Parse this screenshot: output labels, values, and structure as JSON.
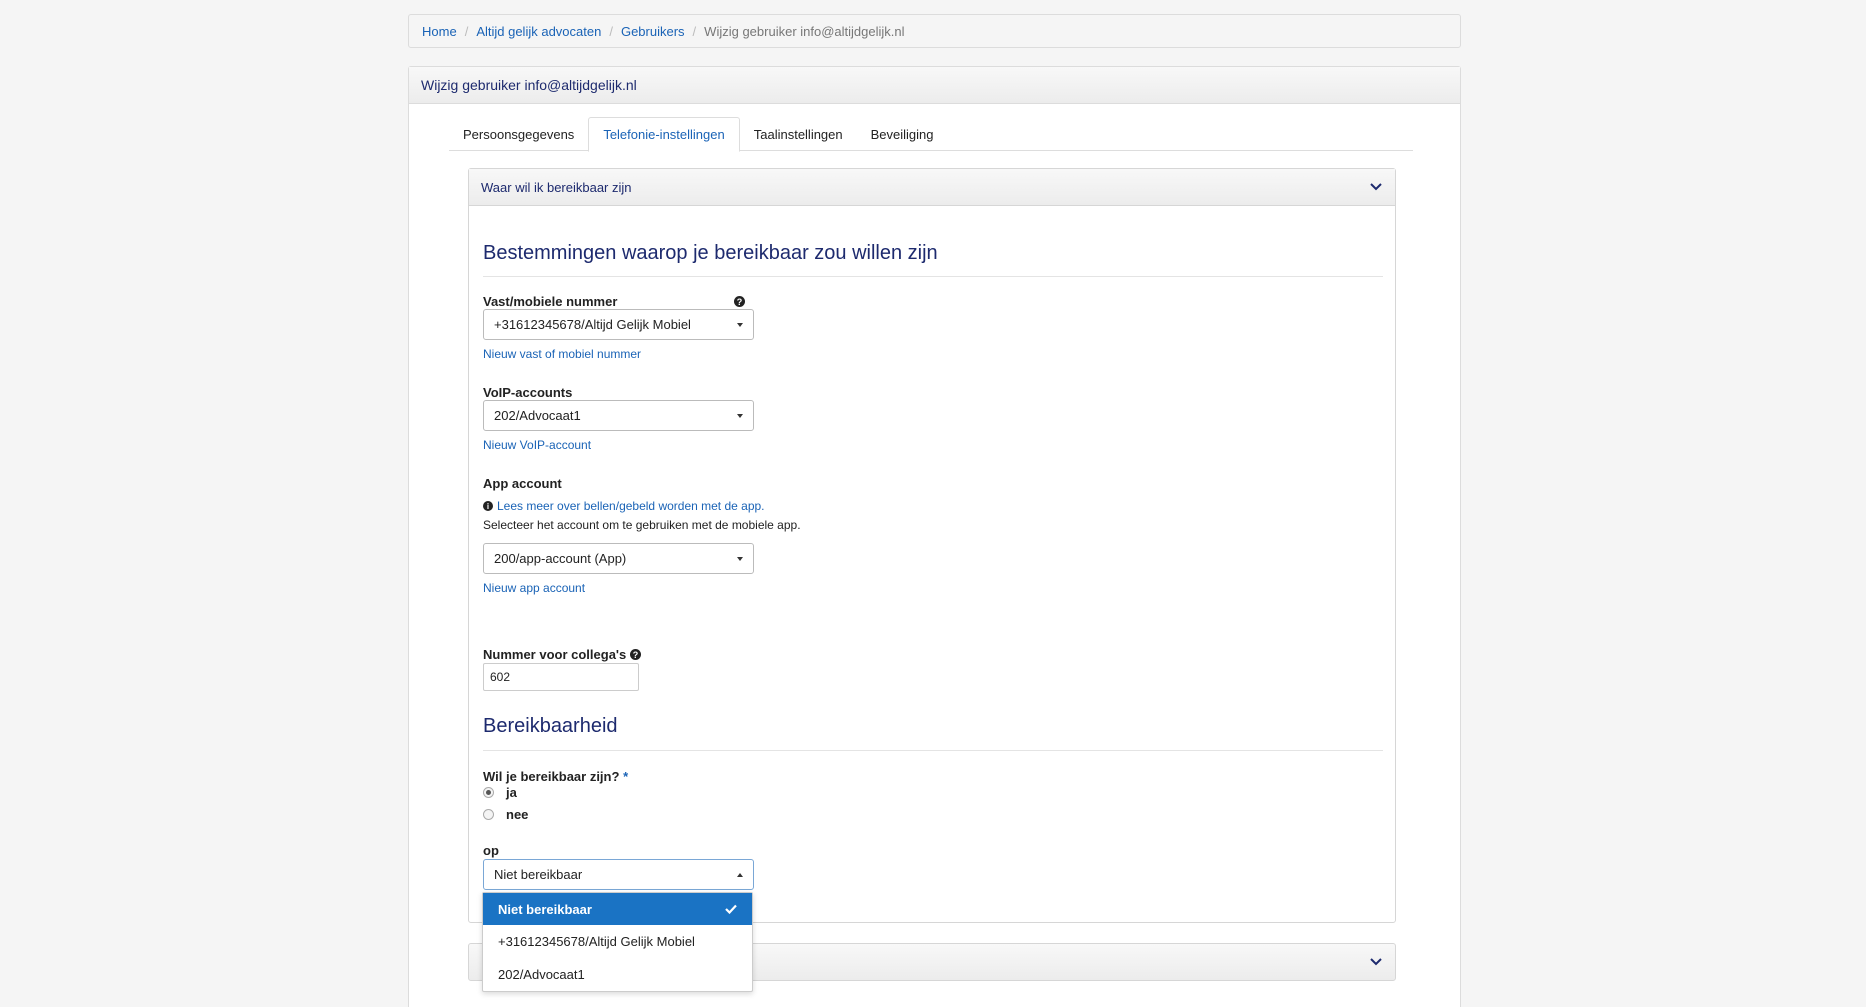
{
  "breadcrumb": {
    "home": "Home",
    "org": "Altijd gelijk advocaten",
    "users": "Gebruikers",
    "current": "Wijzig gebruiker info@altijdgelijk.nl",
    "separator": "/"
  },
  "panel": {
    "title": "Wijzig gebruiker info@altijdgelijk.nl"
  },
  "tabs": [
    {
      "label": "Persoonsgegevens",
      "active": false
    },
    {
      "label": "Telefonie-instellingen",
      "active": true
    },
    {
      "label": "Taalinstellingen",
      "active": false
    },
    {
      "label": "Beveiliging",
      "active": false
    }
  ],
  "accordion": {
    "title": "Waar wil ik bereikbaar zijn",
    "section1_title": "Bestemmingen waarop je bereikbaar zou willen zijn",
    "fixed_mobile": {
      "label": "Vast/mobiele nummer",
      "value": "+31612345678/Altijd Gelijk Mobiel",
      "link": "Nieuw vast of mobiel nummer"
    },
    "voip": {
      "label": "VoIP-accounts",
      "value": "202/Advocaat1",
      "link": "Nieuw VoIP-account"
    },
    "app": {
      "label": "App account",
      "info_link": "Lees meer over bellen/gebeld worden met de app.",
      "help_text": "Selecteer het account om te gebruiken met de mobiele app.",
      "value": "200/app-account (App)",
      "link": "Nieuw app account"
    },
    "colleague": {
      "label": "Nummer voor collega's",
      "value": "602"
    },
    "section2_title": "Bereikbaarheid",
    "reachable": {
      "label": "Wil je bereikbaar zijn?",
      "required": "*",
      "options": [
        "ja",
        "nee"
      ],
      "selected": "ja"
    },
    "op": {
      "label": "op",
      "value": "Niet bereikbaar"
    }
  },
  "dropdown": {
    "items": [
      "Niet bereikbaar",
      "+31612345678/Altijd Gelijk Mobiel",
      "202/Advocaat1"
    ],
    "selected": "Niet bereikbaar"
  },
  "colors": {
    "accent": "#1a73c4",
    "heading": "#1d2a6e",
    "link": "#1a63b6"
  }
}
